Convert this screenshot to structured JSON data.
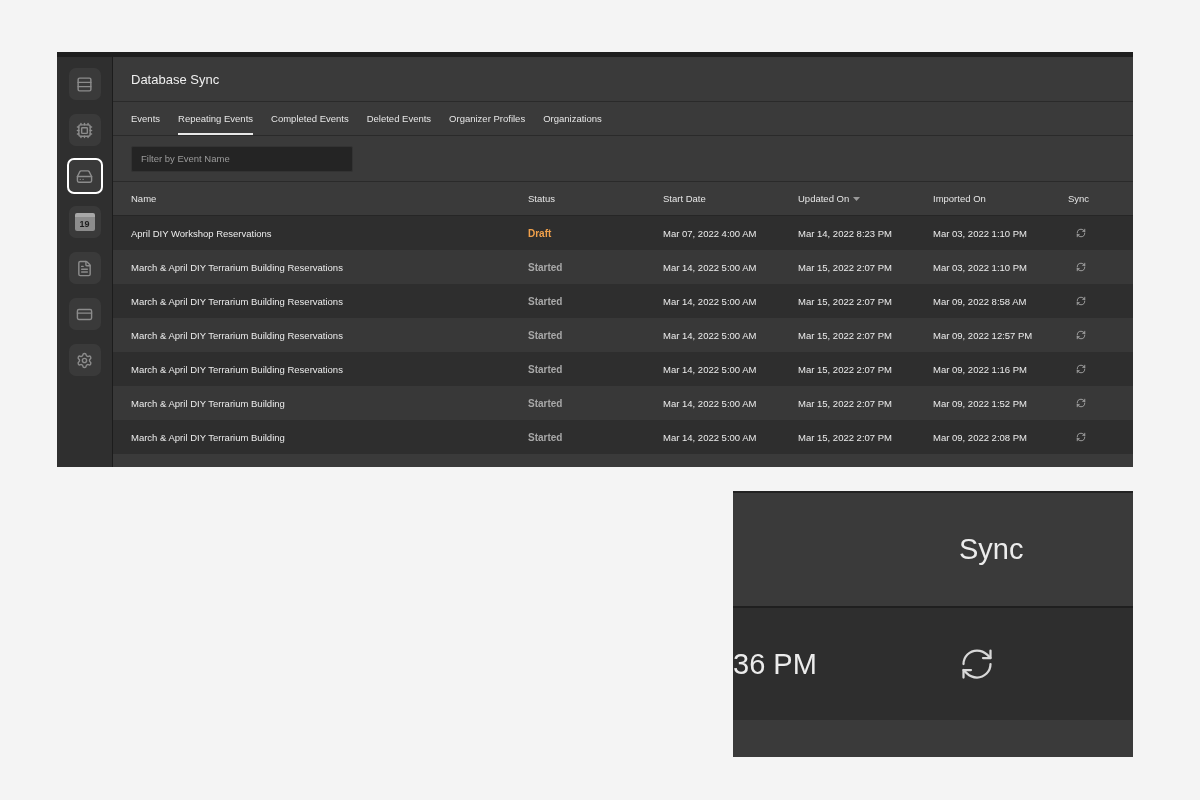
{
  "window": {
    "title": "Database Sync"
  },
  "sidebar": {
    "items": [
      {
        "kind": "rows",
        "selected": false
      },
      {
        "kind": "chip",
        "selected": false
      },
      {
        "kind": "drive",
        "selected": true
      },
      {
        "kind": "calendar",
        "selected": false,
        "badge": "19"
      },
      {
        "kind": "document",
        "selected": false
      },
      {
        "kind": "card",
        "selected": false
      },
      {
        "kind": "gear",
        "selected": false
      }
    ]
  },
  "tabs": [
    {
      "label": "Events",
      "selected": false
    },
    {
      "label": "Repeating Events",
      "selected": true
    },
    {
      "label": "Completed Events",
      "selected": false
    },
    {
      "label": "Deleted Events",
      "selected": false
    },
    {
      "label": "Organizer Profiles",
      "selected": false
    },
    {
      "label": "Organizations",
      "selected": false
    }
  ],
  "filter": {
    "placeholder": "Filter by Event Name"
  },
  "table": {
    "columns": [
      {
        "label": "Name",
        "sorted": false
      },
      {
        "label": "Status",
        "sorted": false
      },
      {
        "label": "Start Date",
        "sorted": false
      },
      {
        "label": "Updated On",
        "sorted": true
      },
      {
        "label": "Imported On",
        "sorted": false
      },
      {
        "label": "Sync",
        "sorted": false
      }
    ],
    "rows": [
      {
        "name": "April DIY Workshop Reservations",
        "status": {
          "text": "Draft",
          "color": "#f0a04b"
        },
        "start": "Mar 07, 2022 4:00 AM",
        "updated": "Mar 14, 2022 8:23 PM",
        "imported": "Mar 03, 2022 1:10 PM"
      },
      {
        "name": "March & April DIY Terrarium Building Reservations",
        "status": {
          "text": "Started",
          "color": "#a8a8a8"
        },
        "start": "Mar 14, 2022 5:00 AM",
        "updated": "Mar 15, 2022 2:07 PM",
        "imported": "Mar 03, 2022 1:10 PM"
      },
      {
        "name": "March & April DIY Terrarium Building Reservations",
        "status": {
          "text": "Started",
          "color": "#a8a8a8"
        },
        "start": "Mar 14, 2022 5:00 AM",
        "updated": "Mar 15, 2022 2:07 PM",
        "imported": "Mar 09, 2022 8:58 AM"
      },
      {
        "name": "March & April DIY Terrarium Building Reservations",
        "status": {
          "text": "Started",
          "color": "#a8a8a8"
        },
        "start": "Mar 14, 2022 5:00 AM",
        "updated": "Mar 15, 2022 2:07 PM",
        "imported": "Mar 09, 2022 12:57 PM"
      },
      {
        "name": "March & April DIY Terrarium Building Reservations",
        "status": {
          "text": "Started",
          "color": "#a8a8a8"
        },
        "start": "Mar 14, 2022 5:00 AM",
        "updated": "Mar 15, 2022 2:07 PM",
        "imported": "Mar 09, 2022 1:16 PM"
      },
      {
        "name": "March & April DIY Terrarium Building",
        "status": {
          "text": "Started",
          "color": "#a8a8a8"
        },
        "start": "Mar 14, 2022 5:00 AM",
        "updated": "Mar 15, 2022 2:07 PM",
        "imported": "Mar 09, 2022 1:52 PM"
      },
      {
        "name": "March & April DIY Terrarium Building",
        "status": {
          "text": "Started",
          "color": "#a8a8a8"
        },
        "start": "Mar 14, 2022 5:00 AM",
        "updated": "Mar 15, 2022 2:07 PM",
        "imported": "Mar 09, 2022 2:08 PM"
      }
    ]
  },
  "zoom_inset": {
    "header": "Sync",
    "cell": "36 PM"
  }
}
